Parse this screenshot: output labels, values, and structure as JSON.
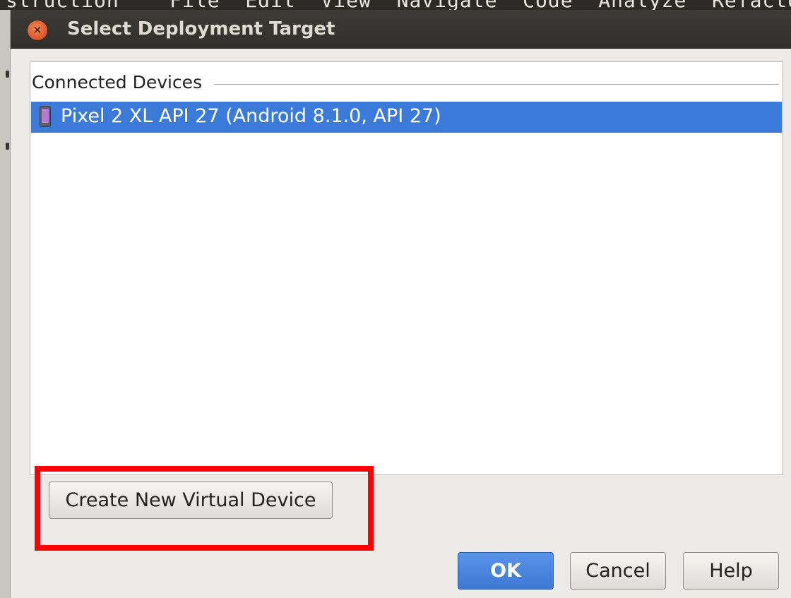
{
  "background_window": {
    "menu_fragment": "struction    File  Edit  View  Navigate  Code  Analyze  Refactor  Build"
  },
  "dialog": {
    "title": "Select Deployment Target",
    "close_icon": "close-icon"
  },
  "device_list": {
    "group_label": "Connected Devices",
    "devices": [
      {
        "icon": "phone-icon",
        "label": "Pixel 2 XL API 27 (Android 8.1.0, API 27)",
        "selected": true
      }
    ]
  },
  "buttons": {
    "create_virtual_device": "Create New Virtual Device",
    "ok": "OK",
    "cancel": "Cancel",
    "help": "Help"
  },
  "colors": {
    "selection": "#3b7ad8",
    "titlebar": "#3c3b37",
    "close_button": "#e05a2b",
    "highlight_frame": "#ff0000",
    "ok_button": "#4a86df"
  }
}
